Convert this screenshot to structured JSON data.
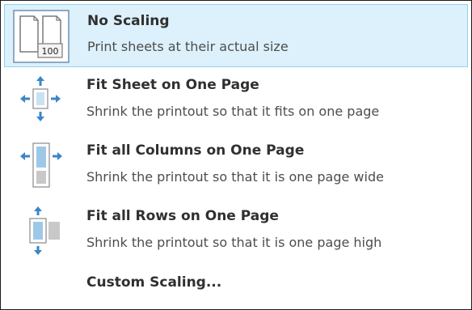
{
  "menu": {
    "items": [
      {
        "title": "No Scaling",
        "description": "Print sheets at their actual size",
        "icon": "no-scaling-icon",
        "icon_badge": "100",
        "selected": true
      },
      {
        "title": "Fit Sheet on One Page",
        "description": "Shrink the printout so that it fits on one page",
        "icon": "fit-sheet-icon",
        "selected": false
      },
      {
        "title": "Fit all Columns on One Page",
        "description": "Shrink the printout so that it is one page wide",
        "icon": "fit-columns-icon",
        "selected": false
      },
      {
        "title": "Fit all Rows on One Page",
        "description": "Shrink the printout so that it is one page high",
        "icon": "fit-rows-icon",
        "selected": false
      },
      {
        "title": "Custom Scaling...",
        "selected": false
      }
    ]
  },
  "colors": {
    "selected_background": "#dcf1fb",
    "selected_border": "#8fd3ef",
    "icon_blue": "#3a86c8",
    "icon_page": "#c9e2f3"
  }
}
